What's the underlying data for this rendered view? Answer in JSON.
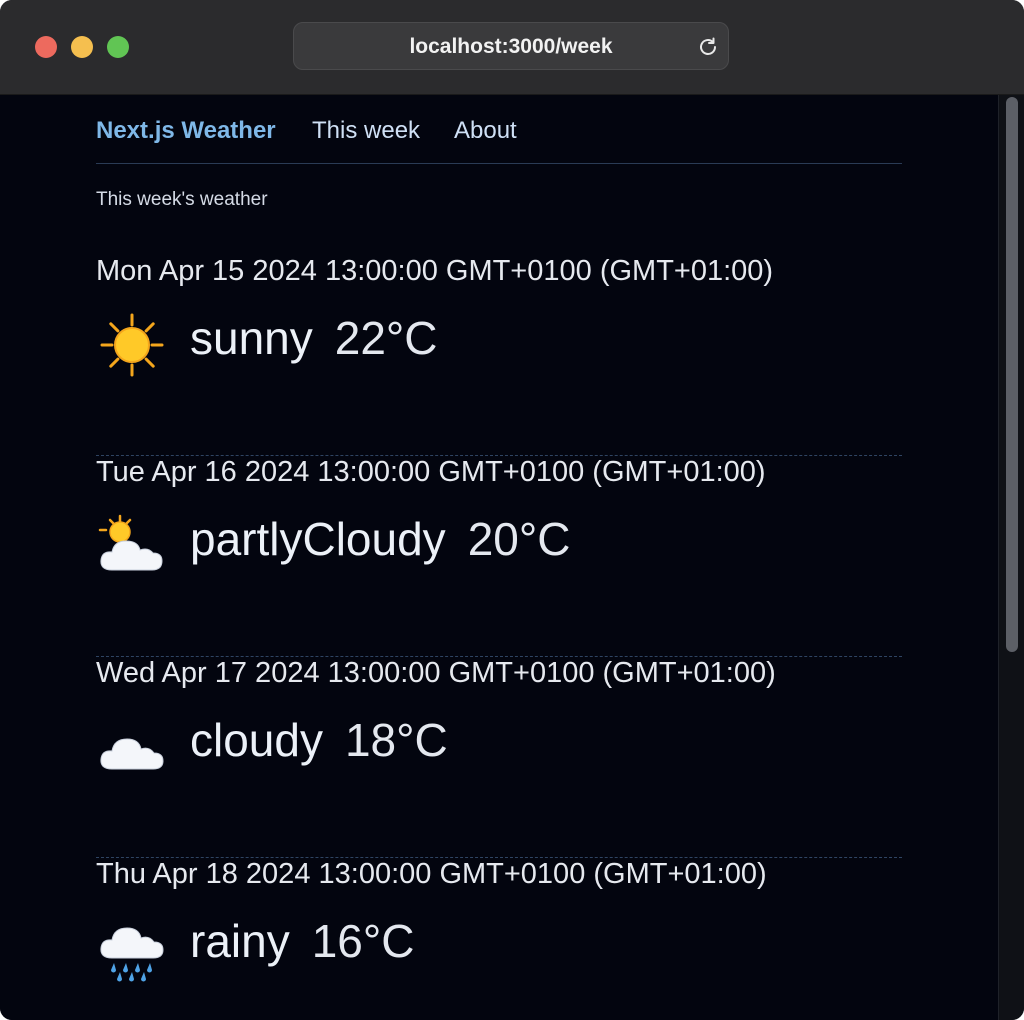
{
  "browser": {
    "url": "localhost:3000/week"
  },
  "nav": {
    "brand": "Next.js Weather",
    "this_week": "This week",
    "about": "About"
  },
  "page": {
    "subtitle": "This week's weather"
  },
  "days": [
    {
      "date": "Mon Apr 15 2024 13:00:00 GMT+0100 (GMT+01:00)",
      "condition": "sunny",
      "temp": "22°C",
      "icon": "sun-icon"
    },
    {
      "date": "Tue Apr 16 2024 13:00:00 GMT+0100 (GMT+01:00)",
      "condition": "partlyCloudy",
      "temp": "20°C",
      "icon": "sun-behind-cloud-icon"
    },
    {
      "date": "Wed Apr 17 2024 13:00:00 GMT+0100 (GMT+01:00)",
      "condition": "cloudy",
      "temp": "18°C",
      "icon": "cloud-icon"
    },
    {
      "date": "Thu Apr 18 2024 13:00:00 GMT+0100 (GMT+01:00)",
      "condition": "rainy",
      "temp": "16°C",
      "icon": "cloud-with-rain-icon"
    }
  ],
  "colors": {
    "background": "#03050f",
    "brand": "#7fb8e8",
    "divider": "#2f4462"
  }
}
